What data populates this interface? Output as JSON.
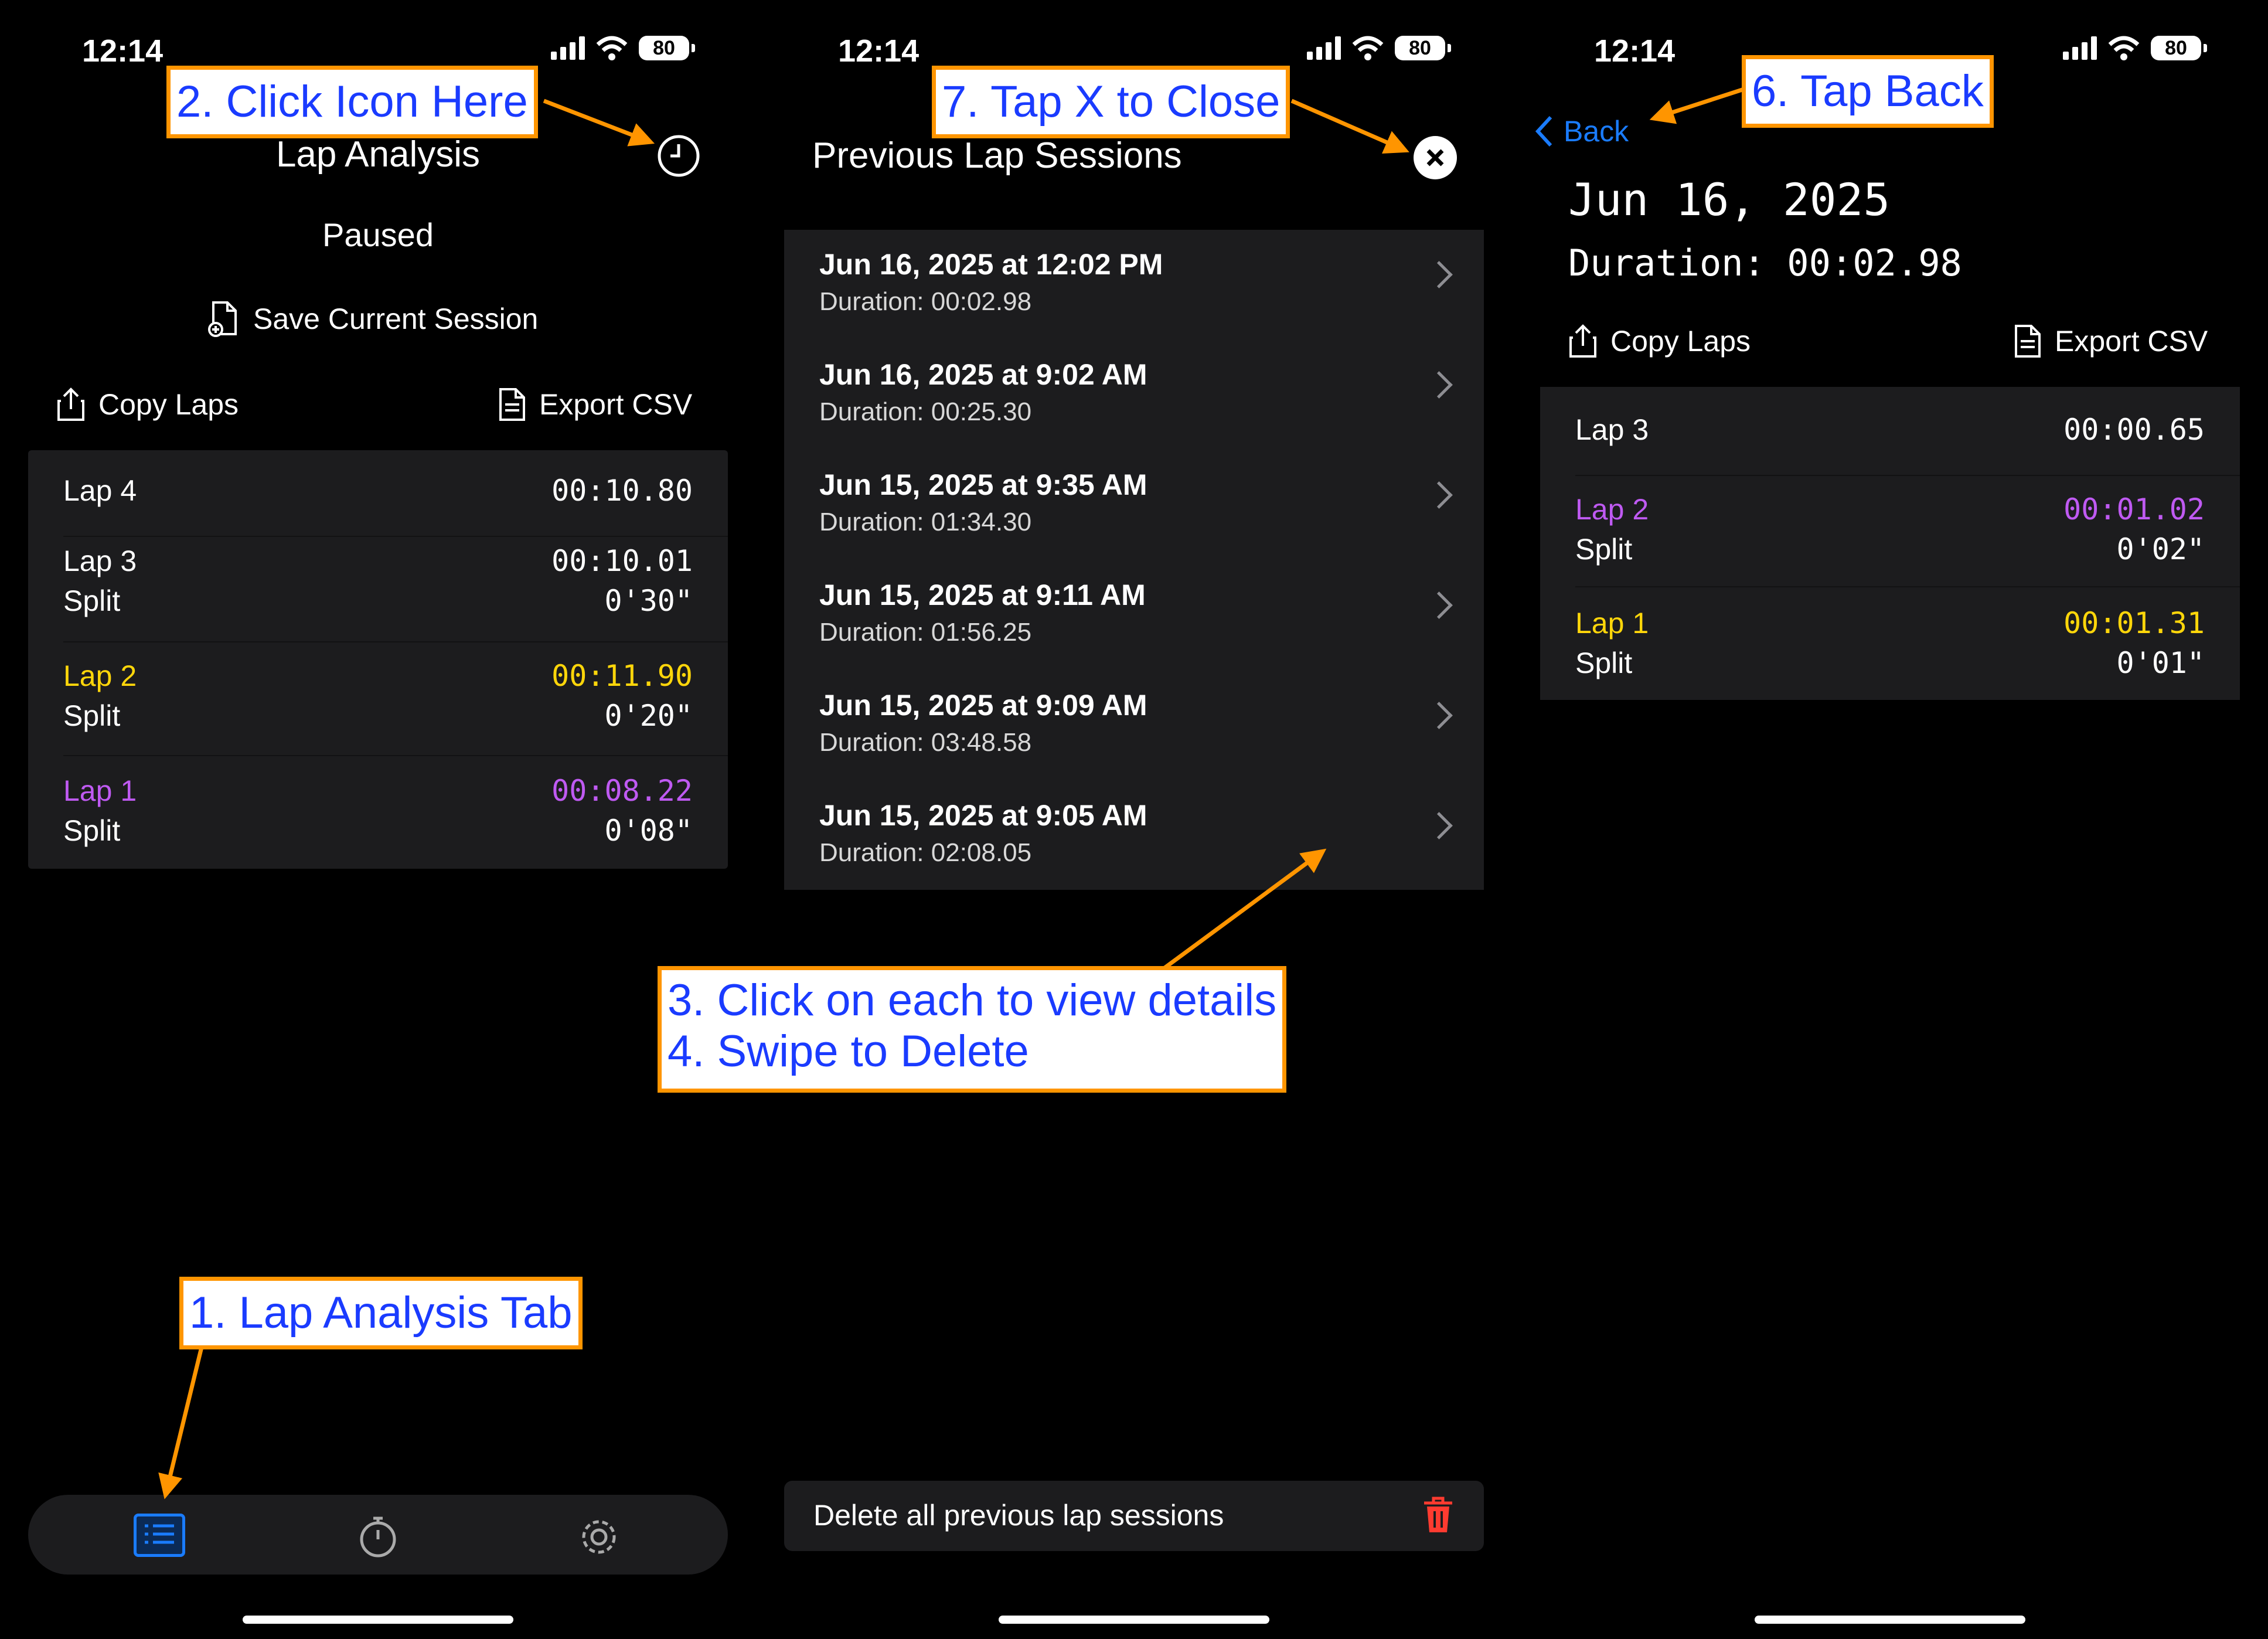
{
  "status": {
    "time": "12:14",
    "battery": "80"
  },
  "screen1": {
    "title": "Lap Analysis",
    "state": "Paused",
    "save_label": "Save Current Session",
    "copy_label": "Copy Laps",
    "export_label": "Export CSV",
    "laps": [
      {
        "name": "Lap 4",
        "time": "00:10.80",
        "split_label": "",
        "split": "",
        "color": "#ffffff"
      },
      {
        "name": "Lap 3",
        "time": "00:10.01",
        "split_label": "Split",
        "split": "0'30\"",
        "color": "#ffffff"
      },
      {
        "name": "Lap 2",
        "time": "00:11.90",
        "split_label": "Split",
        "split": "0'20\"",
        "color": "#ffd60a"
      },
      {
        "name": "Lap 1",
        "time": "00:08.22",
        "split_label": "Split",
        "split": "0'08\"",
        "color": "#bf5af2"
      }
    ]
  },
  "screen2": {
    "title": "Previous Lap Sessions",
    "sessions": [
      {
        "title": "Jun 16, 2025 at 12:02 PM",
        "duration": "Duration: 00:02.98"
      },
      {
        "title": "Jun 16, 2025 at 9:02 AM",
        "duration": "Duration: 00:25.30"
      },
      {
        "title": "Jun 15, 2025 at 9:35 AM",
        "duration": "Duration: 01:34.30"
      },
      {
        "title": "Jun 15, 2025 at 9:11 AM",
        "duration": "Duration: 01:56.25"
      },
      {
        "title": "Jun 15, 2025 at 9:09 AM",
        "duration": "Duration: 03:48.58"
      },
      {
        "title": "Jun 15, 2025 at 9:05 AM",
        "duration": "Duration: 02:08.05"
      }
    ],
    "delete_all_label": "Delete all previous lap sessions"
  },
  "screen3": {
    "back_label": "Back",
    "date": "Jun 16, 2025",
    "duration": "Duration: 00:02.98",
    "copy_label": "Copy Laps",
    "export_label": "Export CSV",
    "laps": [
      {
        "name": "Lap 3",
        "time": "00:00.65",
        "split_label": "",
        "split": "",
        "color": "#ffffff"
      },
      {
        "name": "Lap 2",
        "time": "00:01.02",
        "split_label": "Split",
        "split": "0'02\"",
        "color": "#bf5af2"
      },
      {
        "name": "Lap 1",
        "time": "00:01.31",
        "split_label": "Split",
        "split": "0'01\"",
        "color": "#ffd60a"
      }
    ]
  },
  "callouts": {
    "c1": "1. Lap Analysis Tab",
    "c2": "2. Click Icon Here",
    "c3a": "3. Click on each to view details",
    "c3b": "4. Swipe to Delete",
    "c6": "6. Tap Back",
    "c7": "7. Tap X to Close"
  },
  "colors": {
    "accent": "#1a7cff",
    "callout_border": "#ff9500",
    "callout_text": "#1a3bff",
    "delete": "#ff3b30"
  },
  "icons": [
    "history-clock-icon",
    "close-circle-icon",
    "share-icon",
    "document-icon",
    "trash-icon",
    "list-tab-icon",
    "stopwatch-tab-icon",
    "gear-tab-icon",
    "chevron-left-icon"
  ]
}
